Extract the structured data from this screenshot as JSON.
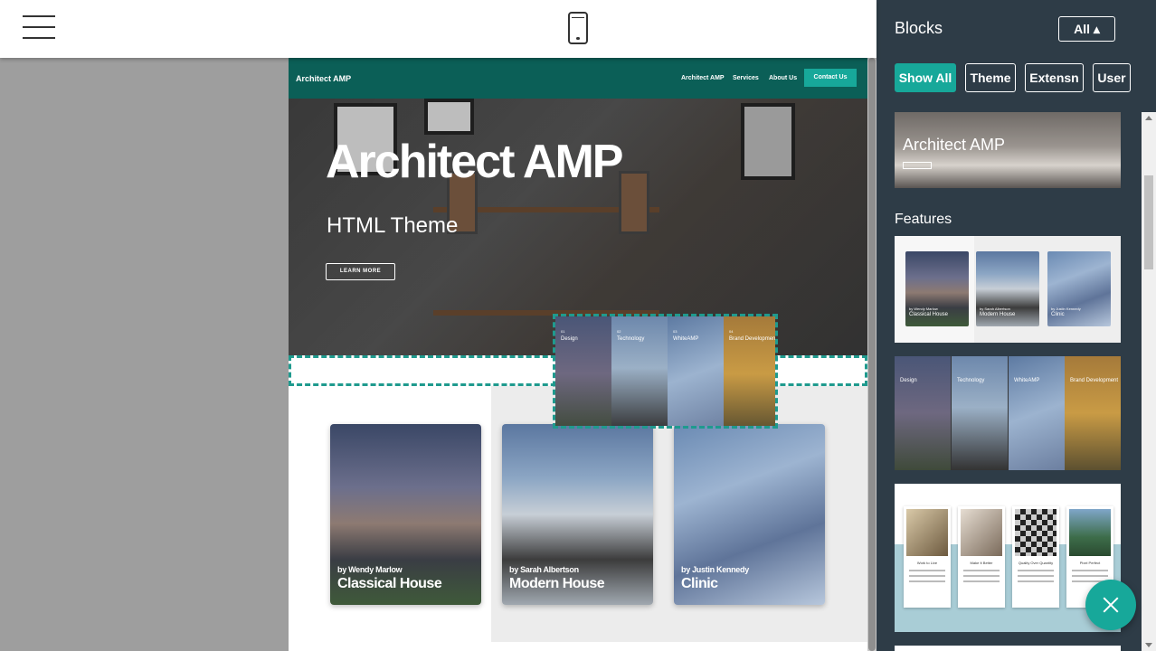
{
  "topbar": {
    "menu_icon": "hamburger-menu-icon",
    "device_icon": "mobile-phone-icon"
  },
  "site": {
    "brand": "Architect AMP",
    "nav": [
      "Architect AMP",
      "Services",
      "About Us"
    ],
    "contact": "Contact Us",
    "hero_title": "Architect AMP",
    "hero_subtitle": "HTML Theme",
    "hero_button": "LEARN MORE",
    "cards": [
      {
        "by": "by Wendy Marlow",
        "name": "Classical House"
      },
      {
        "by": "by Sarah Albertson",
        "name": "Modern House"
      },
      {
        "by": "by Justin Kennedy",
        "name": "Clinic"
      }
    ],
    "drag_panels": [
      {
        "num": "01",
        "label": "Design"
      },
      {
        "num": "02",
        "label": "Technology"
      },
      {
        "num": "03",
        "label": "WhiteAMP"
      },
      {
        "num": "04",
        "label": "Brand Development"
      }
    ]
  },
  "panel": {
    "title": "Blocks",
    "all_button": "All ▴",
    "filters": [
      "Show All",
      "Theme",
      "Extensn",
      "User"
    ],
    "active_filter": "Show All",
    "hero_thumb_title": "Architect AMP",
    "features_label": "Features",
    "features_thumb": [
      {
        "by": "by Wendy Marlow",
        "name": "Classical House"
      },
      {
        "by": "by Sarah Albertson",
        "name": "Modern House"
      },
      {
        "by": "by Justin Kennedy",
        "name": "Clinic"
      }
    ],
    "panels_thumb": [
      {
        "label": "Design"
      },
      {
        "label": "Technology"
      },
      {
        "label": "WhiteAMP"
      },
      {
        "label": "Brand Development"
      }
    ],
    "cards_thumb": [
      {
        "title": "Work to Live"
      },
      {
        "title": "Make It Better"
      },
      {
        "title": "Quality Over Quantity"
      },
      {
        "title": "Pixel Perfect"
      }
    ]
  },
  "fab_icon": "close-icon",
  "colors": {
    "accent": "#17a89a",
    "site_nav": "#0b5f57",
    "panel_bg": "#2e3c47"
  }
}
